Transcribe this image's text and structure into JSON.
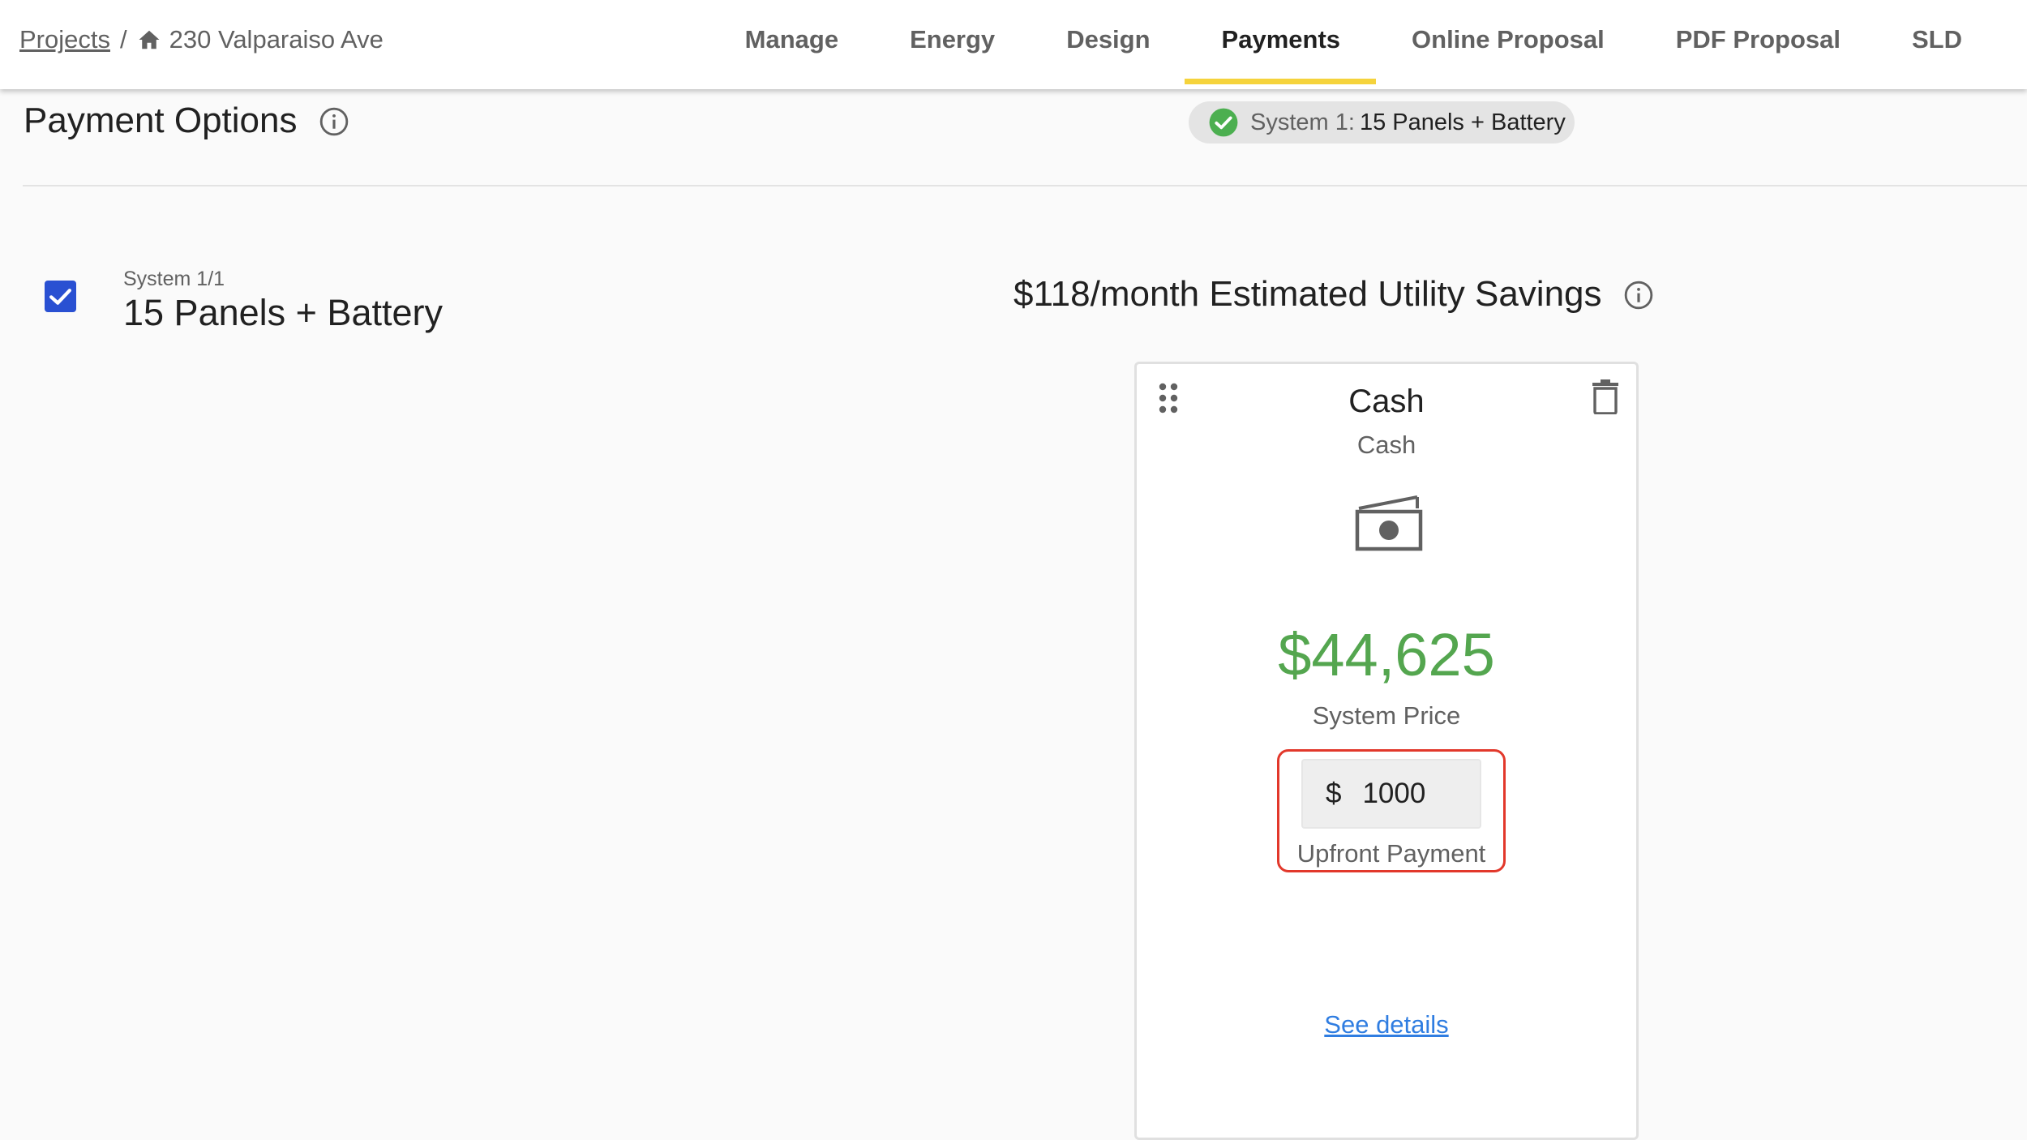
{
  "breadcrumb": {
    "root_label": "Projects",
    "separator": "/",
    "address": "230 Valparaiso Ave",
    "home_icon": "home-icon"
  },
  "nav": {
    "tabs": [
      {
        "label": "Manage",
        "active": false
      },
      {
        "label": "Energy",
        "active": false
      },
      {
        "label": "Design",
        "active": false
      },
      {
        "label": "Payments",
        "active": true
      },
      {
        "label": "Online Proposal",
        "active": false
      },
      {
        "label": "PDF Proposal",
        "active": false
      },
      {
        "label": "SLD",
        "active": false
      }
    ],
    "active_indicator_color": "#f5d33c"
  },
  "header": {
    "title": "Payment Options",
    "info_icon": "info-icon"
  },
  "system_chip": {
    "prefix": "System 1:",
    "name": "15 Panels + Battery",
    "status_icon": "check-circle-icon",
    "status_color": "#4caf50"
  },
  "system": {
    "checked": true,
    "index_label": "System 1/1",
    "name": "15 Panels + Battery",
    "checkbox_color": "#2950d2"
  },
  "savings": {
    "text": "$118/month Estimated Utility Savings",
    "info_icon": "info-icon"
  },
  "cash_card": {
    "title": "Cash",
    "subtitle": "Cash",
    "icon": "cash-icon",
    "price": "$44,625",
    "price_color": "#54a64f",
    "price_label": "System Price",
    "upfront": {
      "currency": "$",
      "value": "1000",
      "label": "Upfront Payment",
      "highlight_color": "#e2382b"
    },
    "details_link": "See details",
    "drag_icon": "drag-handle-icon",
    "delete_icon": "trash-icon"
  }
}
